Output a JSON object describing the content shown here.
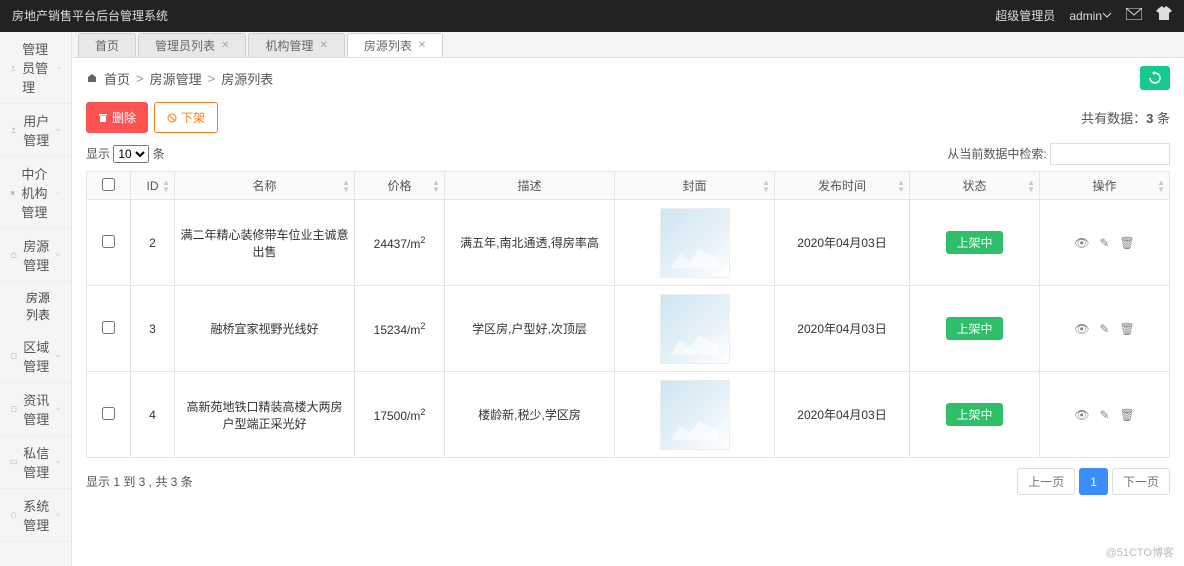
{
  "brand": "房地产销售平台后台管理系统",
  "user_role": "超级管理员",
  "user_name": "admin",
  "sidebar": {
    "items": [
      {
        "label": "管理员管理"
      },
      {
        "label": "用户管理"
      },
      {
        "label": "中介机构管理"
      },
      {
        "label": "房源管理"
      },
      {
        "label": "区域管理"
      },
      {
        "label": "资讯管理"
      },
      {
        "label": "私信管理"
      },
      {
        "label": "系统管理"
      }
    ],
    "sub_label": "房源列表"
  },
  "tabs": [
    {
      "label": "首页",
      "closable": false
    },
    {
      "label": "管理员列表",
      "closable": true
    },
    {
      "label": "机构管理",
      "closable": true
    },
    {
      "label": "房源列表",
      "closable": true
    }
  ],
  "crumbs": [
    "首页",
    "房源管理",
    "房源列表"
  ],
  "toolbar": {
    "delete": "删除",
    "remove": "下架"
  },
  "count_prefix": "共有数据：",
  "count_value": "3",
  "count_suffix": " 条",
  "show_prefix": "显示",
  "show_val": "10",
  "show_suffix": "条",
  "search_label": "从当前数据中检索:",
  "columns": [
    "",
    "ID",
    "名称",
    "价格",
    "描述",
    "封面",
    "发布时间",
    "状态",
    "操作"
  ],
  "rows": [
    {
      "id": "2",
      "name": "满二年精心装修带车位业主诚意出售",
      "price_num": "24437",
      "price_unit": "/m",
      "desc": "满五年,南北通透,得房率高",
      "time": "2020年04月03日",
      "status": "上架中"
    },
    {
      "id": "3",
      "name": "融桥宜家视野光线好",
      "price_num": "15234",
      "price_unit": "/m",
      "desc": "学区房,户型好,次顶层",
      "time": "2020年04月03日",
      "status": "上架中"
    },
    {
      "id": "4",
      "name": "高新苑地铁口精装高楼大两房 户型端正采光好",
      "price_num": "17500",
      "price_unit": "/m",
      "desc": "楼龄新,税少,学区房",
      "time": "2020年04月03日",
      "status": "上架中"
    }
  ],
  "footer_info": "显示 1 到 3 , 共 3 条",
  "prev": "上一页",
  "page1": "1",
  "next": "下一页",
  "watermark": "@51CTO博客"
}
